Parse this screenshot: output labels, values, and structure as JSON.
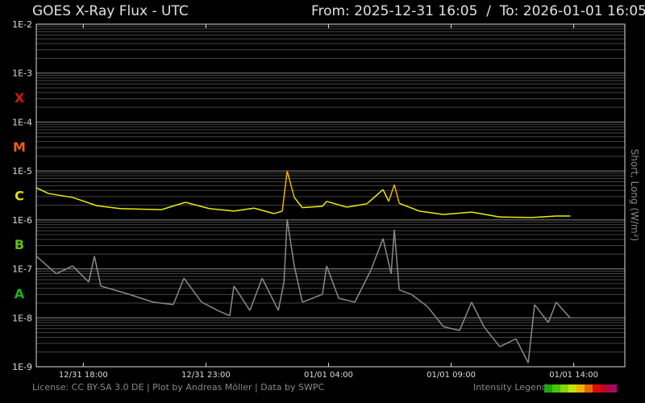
{
  "header": {
    "title": "GOES X-Ray Flux - UTC",
    "from_label": "From:",
    "from": "2025-12-31 16:05",
    "separator": "/",
    "to_label": "To:",
    "to": "2026-01-01 16:05"
  },
  "footer": {
    "license": "License: CC BY-SA 3.0 DE | Plot by Andreas Möller | Data by SWPC",
    "legend_label": "Intensity Legend",
    "legend_colors": [
      "#1ea80a",
      "#4cc40a",
      "#84d80a",
      "#c8e00a",
      "#f0b400",
      "#e86410",
      "#e00a0a",
      "#b40a28",
      "#a00a64"
    ]
  },
  "chart_data": {
    "type": "line",
    "title": "GOES X-Ray Flux - UTC",
    "ylabel": "Short, Long (W/m²)",
    "yscale": "log",
    "ylim": [
      1e-09,
      0.01
    ],
    "ytick_labels": [
      "1E-2",
      "1E-3",
      "1E-4",
      "1E-5",
      "1E-6",
      "1E-7",
      "1E-8",
      "1E-9"
    ],
    "class_labels": [
      {
        "label": "X",
        "color": "#d01818",
        "log": -3.5
      },
      {
        "label": "M",
        "color": "#e86010",
        "log": -4.5
      },
      {
        "label": "C",
        "color": "#e0e010",
        "log": -5.5
      },
      {
        "label": "B",
        "color": "#60c010",
        "log": -6.5
      },
      {
        "label": "A",
        "color": "#20b020",
        "log": -7.5
      }
    ],
    "x_hours_range": [
      0,
      24
    ],
    "xtick_labels": [
      {
        "label": "12/31 18:00",
        "h": 1.9167
      },
      {
        "label": "12/31 23:00",
        "h": 6.9167
      },
      {
        "label": "01/01 04:00",
        "h": 11.9167
      },
      {
        "label": "01/01 09:00",
        "h": 16.9167
      },
      {
        "label": "01/01 14:00",
        "h": 21.9167
      }
    ],
    "series": [
      {
        "name": "Long",
        "color": "#e8f000",
        "peak_color": "#f0b000",
        "h": [
          0,
          0.49,
          1.48,
          2.47,
          3.45,
          5.1,
          6.08,
          7.07,
          8.06,
          8.88,
          9.7,
          10.03,
          10.23,
          10.52,
          10.85,
          11.67,
          11.84,
          12.66,
          13.48,
          14.14,
          14.37,
          14.6,
          14.8,
          15.62,
          16.6,
          17.75,
          18.9,
          20.22,
          21.2,
          21.78
        ],
        "log": [
          -5.34,
          -5.46,
          -5.54,
          -5.71,
          -5.77,
          -5.79,
          -5.64,
          -5.77,
          -5.82,
          -5.76,
          -5.87,
          -5.82,
          -5.0,
          -5.54,
          -5.75,
          -5.72,
          -5.62,
          -5.74,
          -5.67,
          -5.38,
          -5.62,
          -5.28,
          -5.66,
          -5.82,
          -5.89,
          -5.84,
          -5.94,
          -5.95,
          -5.92,
          -5.92
        ]
      },
      {
        "name": "Short",
        "color": "#8a8a8a",
        "h": [
          0,
          0.82,
          1.48,
          2.14,
          2.37,
          2.63,
          3.78,
          4.77,
          5.59,
          6.02,
          6.74,
          7.4,
          7.89,
          8.06,
          8.71,
          9.21,
          9.87,
          10.1,
          10.23,
          10.52,
          10.85,
          11.67,
          11.84,
          12.33,
          12.99,
          13.65,
          14.14,
          14.47,
          14.6,
          14.8,
          15.29,
          15.95,
          16.6,
          17.26,
          17.75,
          18.25,
          18.9,
          19.56,
          20.06,
          20.32,
          20.88,
          21.2,
          21.78
        ],
        "log": [
          -6.74,
          -7.1,
          -6.94,
          -7.27,
          -6.74,
          -7.35,
          -7.52,
          -7.68,
          -7.73,
          -7.19,
          -7.68,
          -7.85,
          -7.96,
          -7.35,
          -7.85,
          -7.19,
          -7.85,
          -7.27,
          -5.99,
          -6.94,
          -7.68,
          -7.52,
          -6.94,
          -7.6,
          -7.68,
          -7.02,
          -6.38,
          -7.1,
          -6.2,
          -7.43,
          -7.52,
          -7.77,
          -8.18,
          -8.26,
          -7.68,
          -8.18,
          -8.59,
          -8.43,
          -8.92,
          -7.73,
          -8.1,
          -7.68,
          -8.01
        ]
      }
    ]
  }
}
